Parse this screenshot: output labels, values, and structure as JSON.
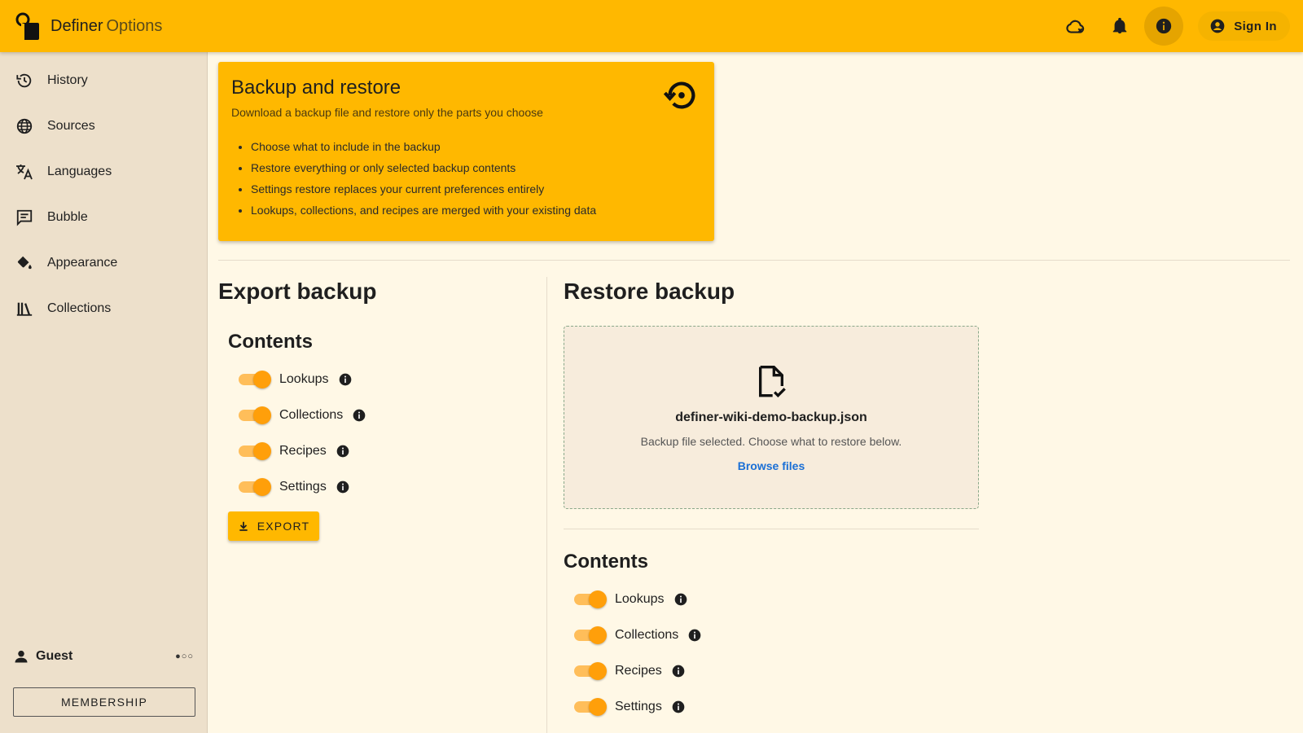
{
  "app": {
    "title": "Definer",
    "subtitle": "Options"
  },
  "topbar": {
    "icons": [
      "cloud-off-icon",
      "bell-icon",
      "info-icon"
    ],
    "signin_label": "Sign In",
    "accent": "#ffb800"
  },
  "sidebar": {
    "items": [
      {
        "label": "History",
        "icon": "history-icon"
      },
      {
        "label": "Sources",
        "icon": "globe-icon"
      },
      {
        "label": "Languages",
        "icon": "translate-icon"
      },
      {
        "label": "Bubble",
        "icon": "chat-bubble-icon"
      },
      {
        "label": "Appearance",
        "icon": "paint-bucket-icon"
      },
      {
        "label": "Collections",
        "icon": "library-icon"
      }
    ],
    "user": "Guest",
    "membership_label": "MEMBERSHIP"
  },
  "hero": {
    "title": "Backup and restore",
    "subtitle": "Download a backup file and restore only the parts you choose",
    "bullets": [
      "Choose what to include in the backup",
      "Restore everything or only selected backup contents",
      "Settings restore replaces your current preferences entirely",
      "Lookups, collections, and recipes are merged with your existing data"
    ]
  },
  "export": {
    "title": "Export backup",
    "contents_title": "Contents",
    "toggles": [
      {
        "label": "Lookups",
        "on": true
      },
      {
        "label": "Collections",
        "on": true
      },
      {
        "label": "Recipes",
        "on": true
      },
      {
        "label": "Settings",
        "on": true
      }
    ],
    "button_label": "EXPORT"
  },
  "restore": {
    "title": "Restore backup",
    "file_name": "definer-wiki-demo-backup.json",
    "file_hint": "Backup file selected. Choose what to restore below.",
    "browse_label": "Browse files",
    "contents_title": "Contents",
    "toggles": [
      {
        "label": "Lookups",
        "on": true
      },
      {
        "label": "Collections",
        "on": true
      },
      {
        "label": "Recipes",
        "on": true
      },
      {
        "label": "Settings",
        "on": true
      }
    ]
  }
}
